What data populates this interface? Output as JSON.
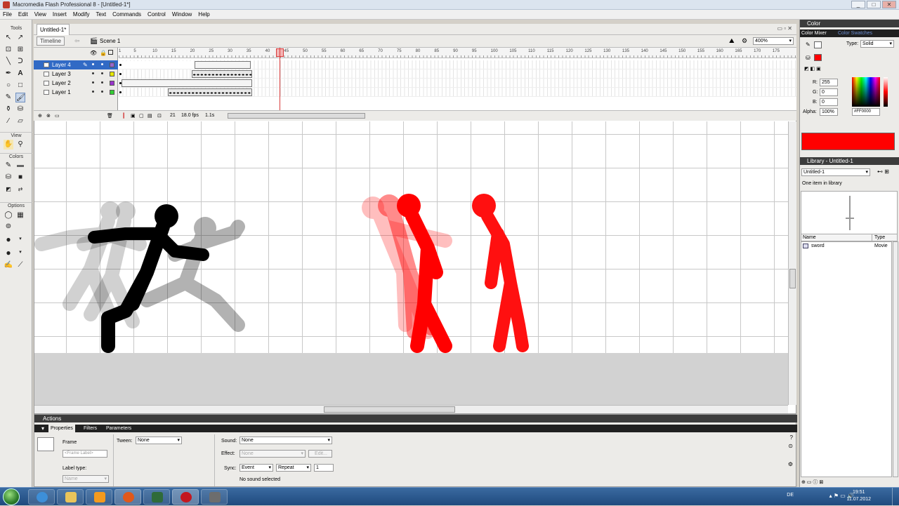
{
  "window": {
    "title": "Macromedia Flash Professional 8 - [Untitled-1*]",
    "min": "_",
    "max": "□",
    "close": "✕"
  },
  "menu": [
    "File",
    "Edit",
    "View",
    "Insert",
    "Modify",
    "Text",
    "Commands",
    "Control",
    "Window",
    "Help"
  ],
  "tools": {
    "header": "Tools",
    "view_label": "View",
    "colors_label": "Colors",
    "options_label": "Options"
  },
  "document": {
    "tab": "Untitled-1*",
    "timeline_button": "Timeline",
    "scene": "Scene 1",
    "zoom": "400%"
  },
  "timeline": {
    "layers": [
      {
        "name": "Layer 4",
        "selected": true,
        "color": "#9966cc"
      },
      {
        "name": "Layer 3",
        "selected": false,
        "color": "#e6e600"
      },
      {
        "name": "Layer 2",
        "selected": false,
        "color": "#9933cc"
      },
      {
        "name": "Layer 1",
        "selected": false,
        "color": "#33cc33"
      }
    ],
    "ruler": [
      "1",
      "5",
      "10",
      "15",
      "20",
      "25",
      "30",
      "35",
      "40",
      "45",
      "50",
      "55",
      "60",
      "65",
      "70",
      "75",
      "80",
      "85",
      "90",
      "95",
      "100",
      "105",
      "110",
      "115",
      "120",
      "125",
      "130",
      "135",
      "140",
      "145",
      "150",
      "155",
      "160",
      "165",
      "170",
      "175"
    ],
    "current_frame": "21",
    "fps": "18.0 fps",
    "elapsed": "1.1s"
  },
  "properties": {
    "actions_header": "Actions",
    "tabs": [
      "Properties",
      "Filters",
      "Parameters"
    ],
    "frame_label": "Frame",
    "frame_placeholder": "<Frame Label>",
    "label_type_label": "Label type:",
    "label_type_value": "Name",
    "tween_label": "Tween:",
    "tween_value": "None",
    "sound_label": "Sound:",
    "sound_value": "None",
    "effect_label": "Effect:",
    "effect_value": "None",
    "edit_button": "Edit...",
    "sync_label": "Sync:",
    "sync_value": "Event",
    "repeat_value": "Repeat",
    "repeat_count": "1",
    "status": "No sound selected"
  },
  "color_panel": {
    "header": "Color",
    "tabs": [
      "Color Mixer",
      "Color Swatches"
    ],
    "type_label": "Type:",
    "type_value": "Solid",
    "r_label": "R:",
    "r": "255",
    "g_label": "G:",
    "g": "0",
    "b_label": "B:",
    "b": "0",
    "alpha_label": "Alpha:",
    "alpha": "100%",
    "hex": "#FF0000",
    "fill_color": "#ff0000"
  },
  "library": {
    "header": "Library - Untitled-1",
    "doc_select": "Untitled-1",
    "count": "One item in library",
    "col_name": "Name",
    "col_type": "Type",
    "items": [
      {
        "name": "sword",
        "type": "Movie"
      }
    ]
  },
  "taskbar": {
    "lang": "DE",
    "time": "19:51",
    "date": "11.07.2012"
  }
}
